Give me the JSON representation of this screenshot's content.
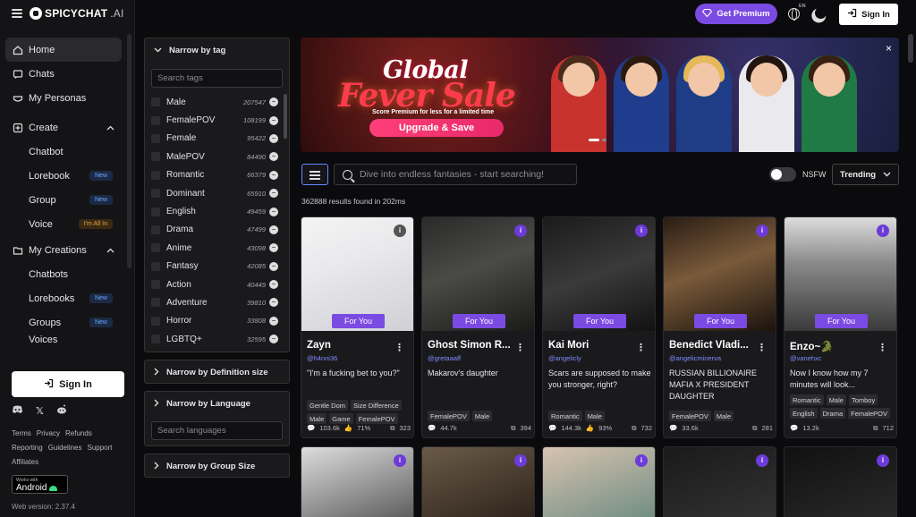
{
  "app": {
    "logo_main": "SPICYCHAT",
    "logo_suffix": ".AI",
    "web_version": "Web version: 2.37.4"
  },
  "topbar": {
    "premium_label": "Get Premium",
    "lang_code": "EN",
    "signin_label": "Sign In"
  },
  "sidebar": {
    "home": "Home",
    "chats": "Chats",
    "personas": "My Personas",
    "create": "Create",
    "create_items": [
      {
        "label": "Chatbot",
        "badge": ""
      },
      {
        "label": "Lorebook",
        "badge": "New"
      },
      {
        "label": "Group",
        "badge": "New"
      },
      {
        "label": "Voice",
        "badge": "I'm All In"
      }
    ],
    "my_creations": "My Creations",
    "creations_items": [
      {
        "label": "Chatbots",
        "badge": ""
      },
      {
        "label": "Lorebooks",
        "badge": "New"
      },
      {
        "label": "Groups",
        "badge": "New"
      },
      {
        "label": "Voices",
        "badge": ""
      }
    ],
    "signin_label": "Sign In",
    "footer_links": [
      "Terms",
      "Privacy",
      "Refunds",
      "Reporting",
      "Guidelines",
      "Support",
      "Affiliates"
    ],
    "android_small": "Works with",
    "android_big": "Android"
  },
  "filters": {
    "tag_header": "Narrow by tag",
    "tag_search_placeholder": "Search tags",
    "tags": [
      {
        "name": "Male",
        "count": "207547"
      },
      {
        "name": "FemalePOV",
        "count": "108199"
      },
      {
        "name": "Female",
        "count": "95422"
      },
      {
        "name": "MalePOV",
        "count": "84490"
      },
      {
        "name": "Romantic",
        "count": "66379"
      },
      {
        "name": "Dominant",
        "count": "65910"
      },
      {
        "name": "English",
        "count": "49459"
      },
      {
        "name": "Drama",
        "count": "47499"
      },
      {
        "name": "Anime",
        "count": "43098"
      },
      {
        "name": "Fantasy",
        "count": "42085"
      },
      {
        "name": "Action",
        "count": "40449"
      },
      {
        "name": "Adventure",
        "count": "39810"
      },
      {
        "name": "Horror",
        "count": "33808"
      },
      {
        "name": "LGBTQ+",
        "count": "32595"
      }
    ],
    "definition_header": "Narrow by Definition size",
    "language_header": "Narrow by Language",
    "language_placeholder": "Search languages",
    "group_header": "Narrow by Group Size"
  },
  "banner": {
    "title_line1": "Global",
    "title_line2": "Fever Sale",
    "subtitle": "Score Premium for less for a limited time",
    "cta": "Upgrade & Save",
    "close": "×"
  },
  "search": {
    "placeholder": "Dive into endless fantasies - start searching!",
    "nsfw_label": "NSFW",
    "sort_value": "Trending",
    "results": "362888 results found in 202ms"
  },
  "cards": [
    {
      "name": "Zayn",
      "handle": "@h4nni36",
      "desc": "\"I'm a fucking bet to you?\"",
      "tags": [
        "Gentle Dom",
        "Size Difference",
        "Male",
        "Game",
        "FemalePOV"
      ],
      "msgs": "103.6k",
      "rating": "71%",
      "bots": "323",
      "badge": "For You"
    },
    {
      "name": "Ghost Simon R...",
      "handle": "@gretaaaff",
      "desc": "Makarov's daughter",
      "tags": [
        "FemalePOV",
        "Male"
      ],
      "msgs": "44.7k",
      "rating": "",
      "bots": "394",
      "badge": "For You"
    },
    {
      "name": "Kai Mori",
      "handle": "@angelicly",
      "desc": "Scars are supposed to make you stronger, right?",
      "tags": [
        "Romantic",
        "Male"
      ],
      "msgs": "144.3k",
      "rating": "93%",
      "bots": "732",
      "badge": "For You"
    },
    {
      "name": "Benedict Vladi...",
      "handle": "@angelicminerva",
      "desc": "RUSSIAN BILLIONAIRE MAFIA X PRESIDENT DAUGHTER",
      "tags": [
        "FemalePOV",
        "Male"
      ],
      "msgs": "33.6k",
      "rating": "",
      "bots": "281",
      "badge": "For You"
    },
    {
      "name": "Enzo~🐊",
      "handle": "@vanehxc",
      "desc": "Now I know how my 7 minutes will look...",
      "tags": [
        "Romantic",
        "Male",
        "Tomboy",
        "English",
        "Drama",
        "FemalePOV"
      ],
      "msgs": "13.2k",
      "rating": "",
      "bots": "712",
      "badge": "For You"
    }
  ]
}
